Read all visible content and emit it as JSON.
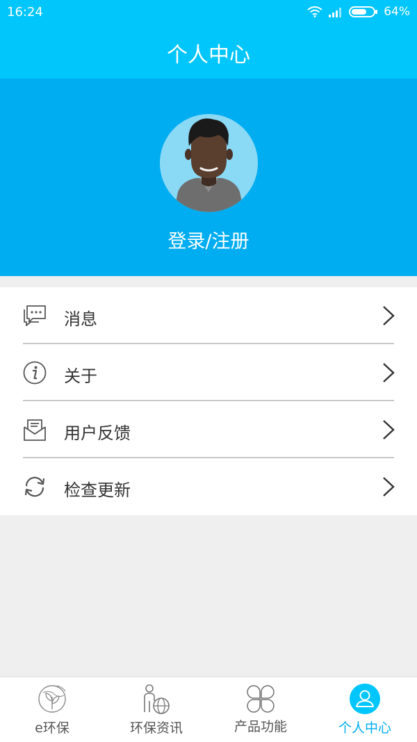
{
  "status_bar": {
    "time": "16:24",
    "battery": "64%",
    "icons": [
      "wifi-icon",
      "signal-icon",
      "battery-icon"
    ]
  },
  "header": {
    "title": "个人中心"
  },
  "profile": {
    "login_text": "登录/注册",
    "avatar_icon": "user-avatar"
  },
  "menu": {
    "items": [
      {
        "label": "消息",
        "icon": "message-icon"
      },
      {
        "label": "关于",
        "icon": "info-icon"
      },
      {
        "label": "用户反馈",
        "icon": "mail-icon"
      },
      {
        "label": "检查更新",
        "icon": "refresh-icon"
      }
    ]
  },
  "tabbar": {
    "items": [
      {
        "label": "e环保",
        "icon": "leaf-globe-icon",
        "active": false
      },
      {
        "label": "环保资讯",
        "icon": "person-globe-icon",
        "active": false
      },
      {
        "label": "产品功能",
        "icon": "clover-grid-icon",
        "active": false
      },
      {
        "label": "个人中心",
        "icon": "user-icon",
        "active": true
      }
    ]
  },
  "colors": {
    "header": "#00c6fb",
    "hero": "#00adf0",
    "accent": "#00adf0",
    "background": "#efefef"
  }
}
